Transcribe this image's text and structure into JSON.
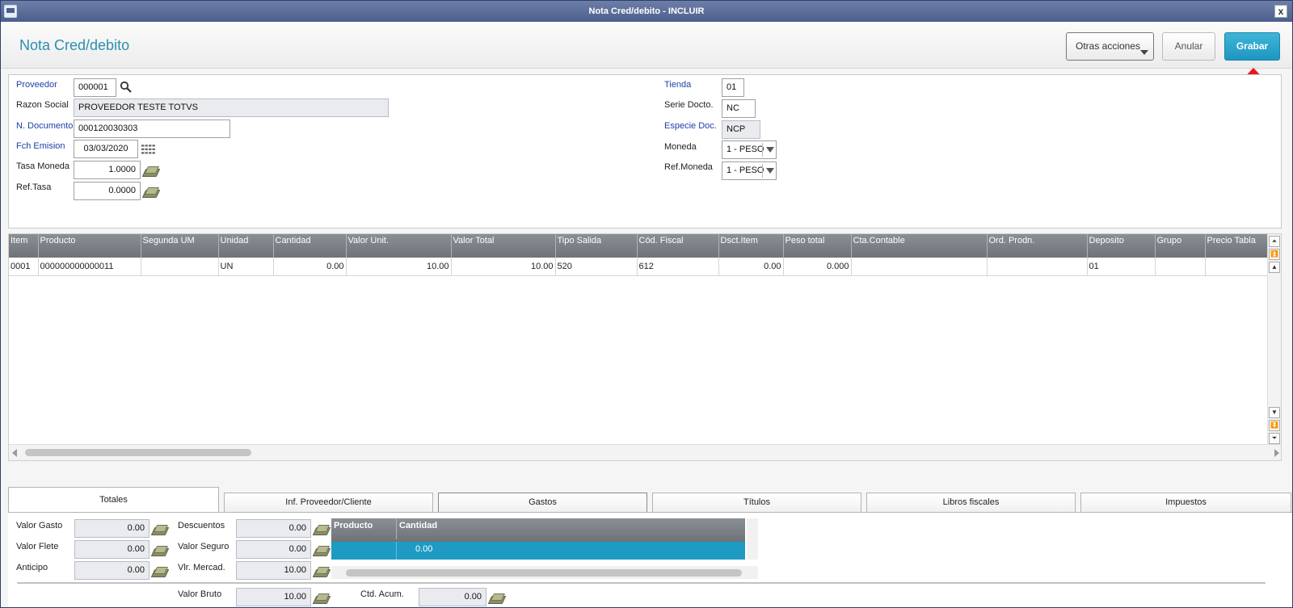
{
  "window": {
    "title": "Nota Cred/debito - INCLUIR",
    "close_label": "x"
  },
  "header": {
    "title": "Nota Cred/debito",
    "buttons": {
      "otras": "Otras acciones",
      "anular": "Anular",
      "grabar": "Grabar"
    }
  },
  "annotation": {
    "arrow_color": "#e8171e",
    "target": "Grabar"
  },
  "form": {
    "left": [
      {
        "label": "Proveedor",
        "value": "000001",
        "required": true
      },
      {
        "label": "Razon Social",
        "value": "PROVEEDOR TESTE TOTVS"
      },
      {
        "label": "N. Documento",
        "value": "000120030303",
        "required": true
      },
      {
        "label": "Fch Emision",
        "value": "03/03/2020",
        "required": true
      },
      {
        "label": "Tasa Moneda",
        "value": "1.0000"
      },
      {
        "label": "Ref.Tasa",
        "value": "0.0000"
      }
    ],
    "right": [
      {
        "label": "Tienda",
        "value": "01",
        "required": true
      },
      {
        "label": "Serie Docto.",
        "value": "NC"
      },
      {
        "label": "Especie Doc.",
        "value": "NCP",
        "required": true
      },
      {
        "label": "Moneda",
        "value": "1 - PESO"
      },
      {
        "label": "Ref.Moneda",
        "value": "1 - PESO"
      }
    ]
  },
  "grid": {
    "columns": [
      "Item",
      "Producto",
      "Segunda UM",
      "Unidad",
      "Cantidad",
      "Valor Unit.",
      "Valor Total",
      "Tipo Salida",
      "Cód. Fiscal",
      "Dsct.Item",
      "Peso total",
      "Cta.Contable",
      "Ord. Prodn.",
      "Deposito",
      "Grupo",
      "Precio Tabla"
    ],
    "rows": [
      [
        "0001",
        "000000000000011",
        "",
        "UN",
        "0.00",
        "10.00",
        "10.00",
        "520",
        "612",
        "0.00",
        "0.000",
        "",
        "",
        "01",
        "",
        ""
      ]
    ]
  },
  "tabs": [
    "Totales",
    "Inf. Proveedor/Cliente",
    "Gastos",
    "Títulos",
    "Libros fiscales",
    "Impuestos"
  ],
  "totals": {
    "col1": [
      {
        "label": "Valor Gasto",
        "value": "0.00"
      },
      {
        "label": "Valor Flete",
        "value": "0.00"
      },
      {
        "label": "Anticipo",
        "value": "0.00"
      }
    ],
    "col2": [
      {
        "label": "Descuentos",
        "value": "0.00"
      },
      {
        "label": "Valor Seguro",
        "value": "0.00"
      },
      {
        "label": "Vlr. Mercad.",
        "value": "10.00"
      }
    ],
    "mini_grid": {
      "columns": [
        "Producto",
        "Cantidad"
      ],
      "row": [
        "",
        "0.00"
      ]
    },
    "bottom": [
      {
        "label": "Valor Bruto",
        "value": "10.00"
      },
      {
        "label": "Ctd. Acum.",
        "value": "0.00"
      }
    ]
  }
}
